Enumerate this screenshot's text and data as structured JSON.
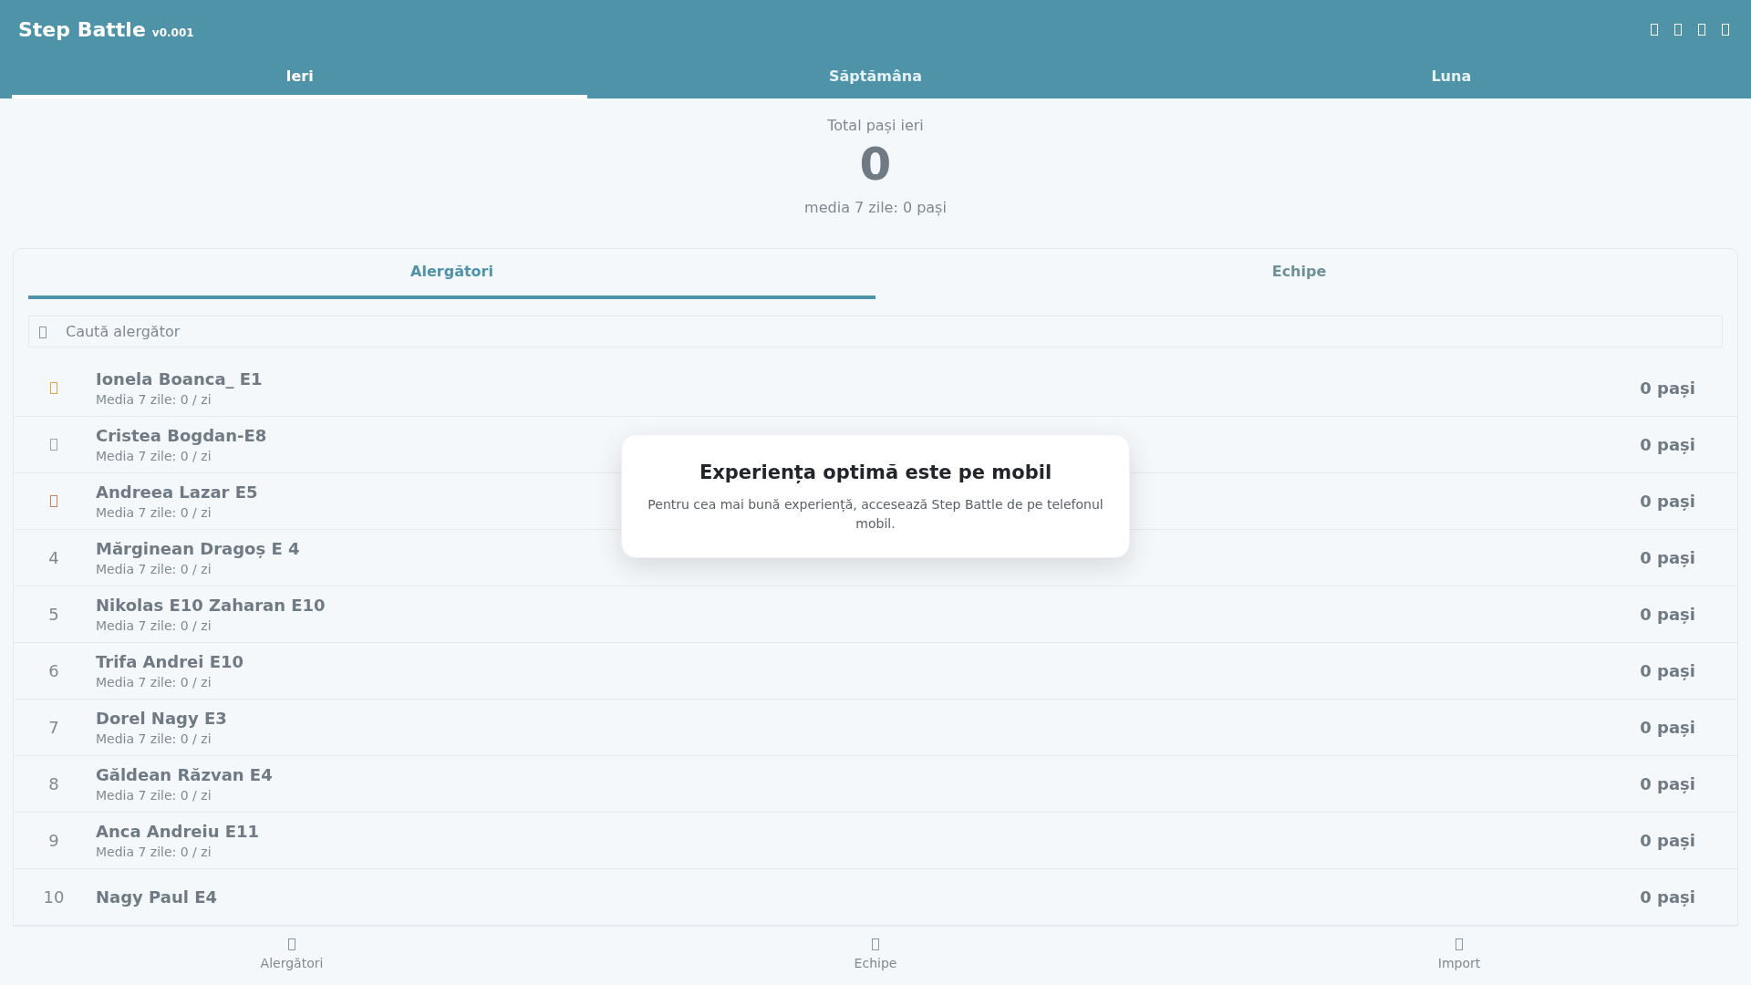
{
  "app": {
    "title": "Step Battle",
    "version": "v0.001"
  },
  "period_tabs": [
    {
      "label": "Ieri",
      "selected": true
    },
    {
      "label": "Săptămâna",
      "selected": false
    },
    {
      "label": "Luna",
      "selected": false
    }
  ],
  "summary": {
    "label": "Total pași ieri",
    "value": "0",
    "average": "media 7 zile: 0 pași"
  },
  "list_tabs": [
    {
      "label": "Alergători",
      "selected": true
    },
    {
      "label": "Echipe",
      "selected": false
    }
  ],
  "search": {
    "placeholder": "Caută alergător"
  },
  "runners": [
    {
      "kind": "medal",
      "color": "#d9a54a",
      "name": "Ionela Boanca_ E1",
      "average": "Media 7 zile: 0 / zi",
      "steps": "0 pași"
    },
    {
      "kind": "medal",
      "color": "#9aa4ae",
      "name": "Cristea Bogdan-E8",
      "average": "Media 7 zile: 0 / zi",
      "steps": "0 pași"
    },
    {
      "kind": "medal",
      "color": "#c9825a",
      "name": "Andreea Lazar E5",
      "average": "Media 7 zile: 0 / zi",
      "steps": "0 pași"
    },
    {
      "kind": "number",
      "rank": "4",
      "name": "Mărginean Dragoș E 4",
      "average": "Media 7 zile: 0 / zi",
      "steps": "0 pași"
    },
    {
      "kind": "number",
      "rank": "5",
      "name": "Nikolas E10 Zaharan E10",
      "average": "Media 7 zile: 0 / zi",
      "steps": "0 pași"
    },
    {
      "kind": "number",
      "rank": "6",
      "name": "Trifa Andrei E10",
      "average": "Media 7 zile: 0 / zi",
      "steps": "0 pași"
    },
    {
      "kind": "number",
      "rank": "7",
      "name": "Dorel Nagy E3",
      "average": "Media 7 zile: 0 / zi",
      "steps": "0 pași"
    },
    {
      "kind": "number",
      "rank": "8",
      "name": "Găldean Răzvan E4",
      "average": "Media 7 zile: 0 / zi",
      "steps": "0 pași"
    },
    {
      "kind": "number",
      "rank": "9",
      "name": "Anca Andreiu E11",
      "average": "Media 7 zile: 0 / zi",
      "steps": "0 pași"
    },
    {
      "kind": "number",
      "rank": "10",
      "name": "Nagy Paul E4",
      "steps": "0 pași"
    }
  ],
  "bottom_nav": [
    {
      "label": "Alergători"
    },
    {
      "label": "Echipe"
    },
    {
      "label": "Import"
    }
  ],
  "dialog": {
    "title": "Experiența optimă este pe mobil",
    "message": "Pentru cea mai bună experiență, accesează Step Battle de pe telefonul mobil."
  }
}
